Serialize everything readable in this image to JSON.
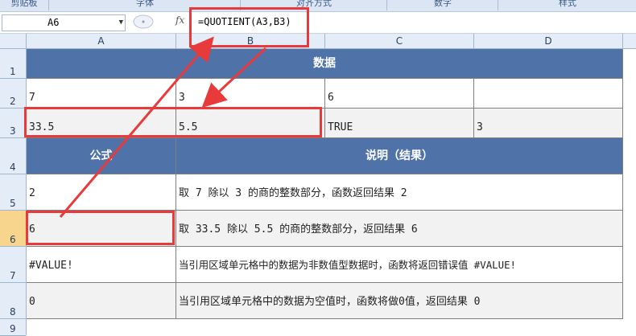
{
  "ribbon": {
    "groups": [
      "剪贴板",
      "字体",
      "对齐方式",
      "数字",
      "样式"
    ]
  },
  "formula_bar": {
    "name_box": "A6",
    "fx_label": "fx",
    "formula": "=QUOTIENT(A3,B3)"
  },
  "columns": [
    "A",
    "B",
    "C",
    "D"
  ],
  "rows": [
    "1",
    "2",
    "3",
    "4",
    "5",
    "6",
    "7",
    "8",
    "9"
  ],
  "sheet": {
    "title": "数据",
    "r2": [
      "7",
      "3",
      "6",
      ""
    ],
    "r3": [
      "33.5",
      "5.5",
      "TRUE",
      "3"
    ],
    "formula_header": "公式",
    "desc_header": "说明（结果）",
    "r5": {
      "formula": "2",
      "desc": "取 7 除以 3 的商的整数部分，函数返回结果 2"
    },
    "r6": {
      "formula": "6",
      "desc": "取 33.5 除以 5.5 的商的整数部分，返回结果 6"
    },
    "r7": {
      "formula": "#VALUE!",
      "desc": "当引用区域单元格中的数据为非数值型数据时，函数将返回错误值 #VALUE!"
    },
    "r8": {
      "formula": "0",
      "desc": "当引用区域单元格中的数据为空值时，函数将做0值，返回结果 0"
    }
  },
  "annotation_color": "#e83a3a"
}
